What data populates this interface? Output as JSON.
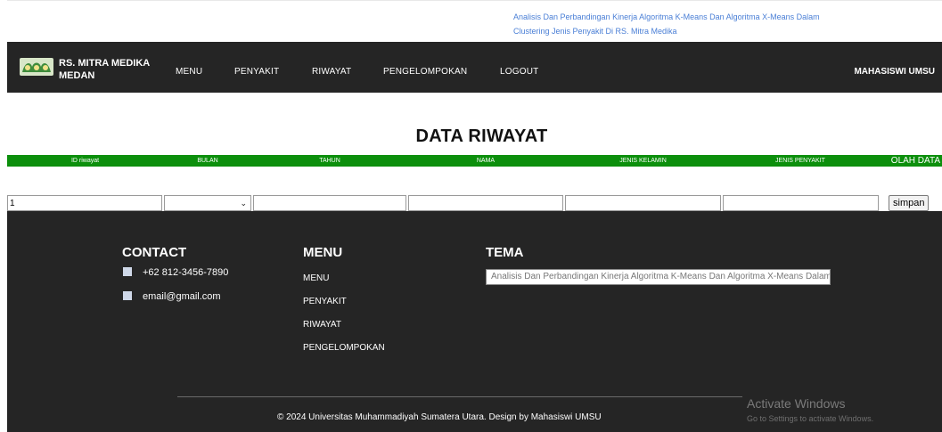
{
  "top_note": "Analisis Dan Perbandingan Kinerja Algoritma K-Means Dan Algoritma X-Means Dalam Clustering Jenis Penyakit Di RS. Mitra Medika",
  "brand": {
    "line1": "RS. MITRA MEDIKA",
    "line2": "MEDAN"
  },
  "nav": {
    "items": [
      "MENU",
      "PENYAKIT",
      "RIWAYAT",
      "PENGELOMPOKAN",
      "LOGOUT"
    ],
    "user": "MAHASISWI UMSU"
  },
  "page_title": "DATA RIWAYAT",
  "table": {
    "headers": [
      "ID riwayat",
      "BULAN",
      "TAHUN",
      "NAMA",
      "JENIS KELAMIN",
      "JENIS PENYAKIT",
      "OLAH DATA"
    ],
    "id_value": "1",
    "submit_label": "simpan"
  },
  "footer": {
    "contact_title": "CONTACT",
    "phone": "+62 812-3456-7890",
    "email": "email@gmail.com",
    "menu_title": "MENU",
    "menu_items": [
      "MENU",
      "PENYAKIT",
      "RIWAYAT",
      "PENGELOMPOKAN"
    ],
    "tema_title": "TEMA",
    "tema_value": "Analisis Dan Perbandingan Kinerja Algoritma K-Means Dan Algoritma X-Means Dalam Clustering Jenis Penyakit Di RS. Mitra Medika",
    "copyright": "© 2024 Universitas Muhammadiyah Sumatera Utara. Design by Mahasiswi UMSU"
  },
  "windows_watermark": {
    "title": "Activate Windows",
    "subtitle": "Go to Settings to activate Windows."
  },
  "colors": {
    "nav_bg": "#252525",
    "header_green": "#0c8f0c",
    "link_blue": "#4a7fd6"
  }
}
